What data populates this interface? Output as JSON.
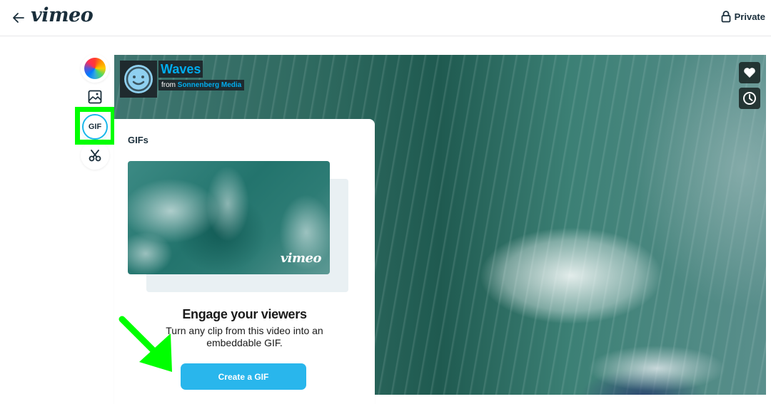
{
  "header": {
    "back_icon": "arrow-left-icon",
    "logo_text": "vimeo",
    "privacy": {
      "icon": "lock-icon",
      "label": "Private"
    }
  },
  "tool_rail": {
    "items": [
      {
        "id": "color",
        "icon": "color-wheel-icon"
      },
      {
        "id": "thumbnail",
        "icon": "image-icon"
      },
      {
        "id": "gif",
        "icon": "gif-icon",
        "label": "GIF",
        "active": true
      },
      {
        "id": "trim",
        "icon": "scissors-icon"
      }
    ],
    "highlight_color": "#00ff00"
  },
  "player": {
    "title": "Waves",
    "byline_prefix": "from",
    "author": "Sonnenberg Media",
    "accent_color": "#00adef",
    "actions": [
      {
        "id": "like",
        "icon": "heart-icon"
      },
      {
        "id": "watch-later",
        "icon": "clock-icon"
      }
    ]
  },
  "gif_panel": {
    "title": "GIFs",
    "preview_watermark": "vimeo",
    "heading": "Engage your viewers",
    "subtext": "Turn any clip from this video into an embeddable GIF.",
    "button_label": "Create a GIF",
    "button_color": "#29b6ec"
  },
  "annotation": {
    "arrow_color": "#00ff00",
    "arrow_target": "create-gif-button"
  }
}
